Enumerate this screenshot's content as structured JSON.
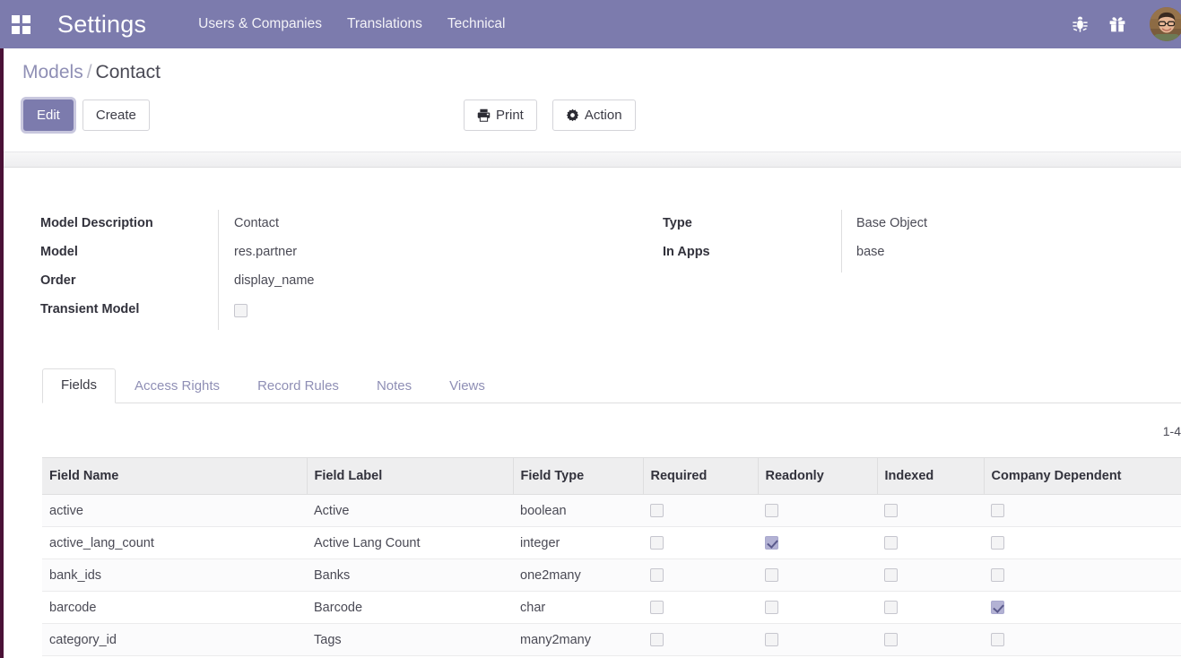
{
  "navbar": {
    "apps_icon": "apps-grid-icon",
    "brand": "Settings",
    "links": [
      {
        "label": "Users & Companies"
      },
      {
        "label": "Translations"
      },
      {
        "label": "Technical"
      }
    ],
    "right_icons": [
      {
        "name": "bug-icon"
      },
      {
        "name": "gift-icon"
      }
    ],
    "avatar": "user-avatar",
    "bg_color": "#7c7bad"
  },
  "control_panel": {
    "breadcrumb": {
      "parent": "Models",
      "separator": "/",
      "current": "Contact"
    },
    "buttons": {
      "edit": "Edit",
      "create": "Create"
    },
    "actions": {
      "print": "Print",
      "action": "Action"
    }
  },
  "form": {
    "left": [
      {
        "label": "Model Description",
        "value": "Contact",
        "type": "text"
      },
      {
        "label": "Model",
        "value": "res.partner",
        "type": "text"
      },
      {
        "label": "Order",
        "value": "display_name",
        "type": "text"
      },
      {
        "label": "Transient Model",
        "value": "",
        "type": "checkbox",
        "checked": false
      }
    ],
    "right": [
      {
        "label": "Type",
        "value": "Base Object",
        "type": "text"
      },
      {
        "label": "In Apps",
        "value": "base",
        "type": "text"
      }
    ]
  },
  "notebook": {
    "tabs": [
      {
        "label": "Fields",
        "active": true
      },
      {
        "label": "Access Rights",
        "active": false
      },
      {
        "label": "Record Rules",
        "active": false
      },
      {
        "label": "Notes",
        "active": false
      },
      {
        "label": "Views",
        "active": false
      }
    ]
  },
  "pager": {
    "text": "1-4"
  },
  "table": {
    "columns": [
      "Field Name",
      "Field Label",
      "Field Type",
      "Required",
      "Readonly",
      "Indexed",
      "Company Dependent"
    ],
    "rows": [
      {
        "field_name": "active",
        "field_label": "Active",
        "field_type": "boolean",
        "required": false,
        "readonly": false,
        "indexed": false,
        "company_dependent": false
      },
      {
        "field_name": "active_lang_count",
        "field_label": "Active Lang Count",
        "field_type": "integer",
        "required": false,
        "readonly": true,
        "indexed": false,
        "company_dependent": false
      },
      {
        "field_name": "bank_ids",
        "field_label": "Banks",
        "field_type": "one2many",
        "required": false,
        "readonly": false,
        "indexed": false,
        "company_dependent": false
      },
      {
        "field_name": "barcode",
        "field_label": "Barcode",
        "field_type": "char",
        "required": false,
        "readonly": false,
        "indexed": false,
        "company_dependent": true
      },
      {
        "field_name": "category_id",
        "field_label": "Tags",
        "field_type": "many2many",
        "required": false,
        "readonly": false,
        "indexed": false,
        "company_dependent": false
      }
    ]
  },
  "colors": {
    "brand_purple": "#7c7bad",
    "edge_accent": "#4a1136",
    "checkbox_checked": "#b3b2d4",
    "link": "#8f8fb5"
  }
}
